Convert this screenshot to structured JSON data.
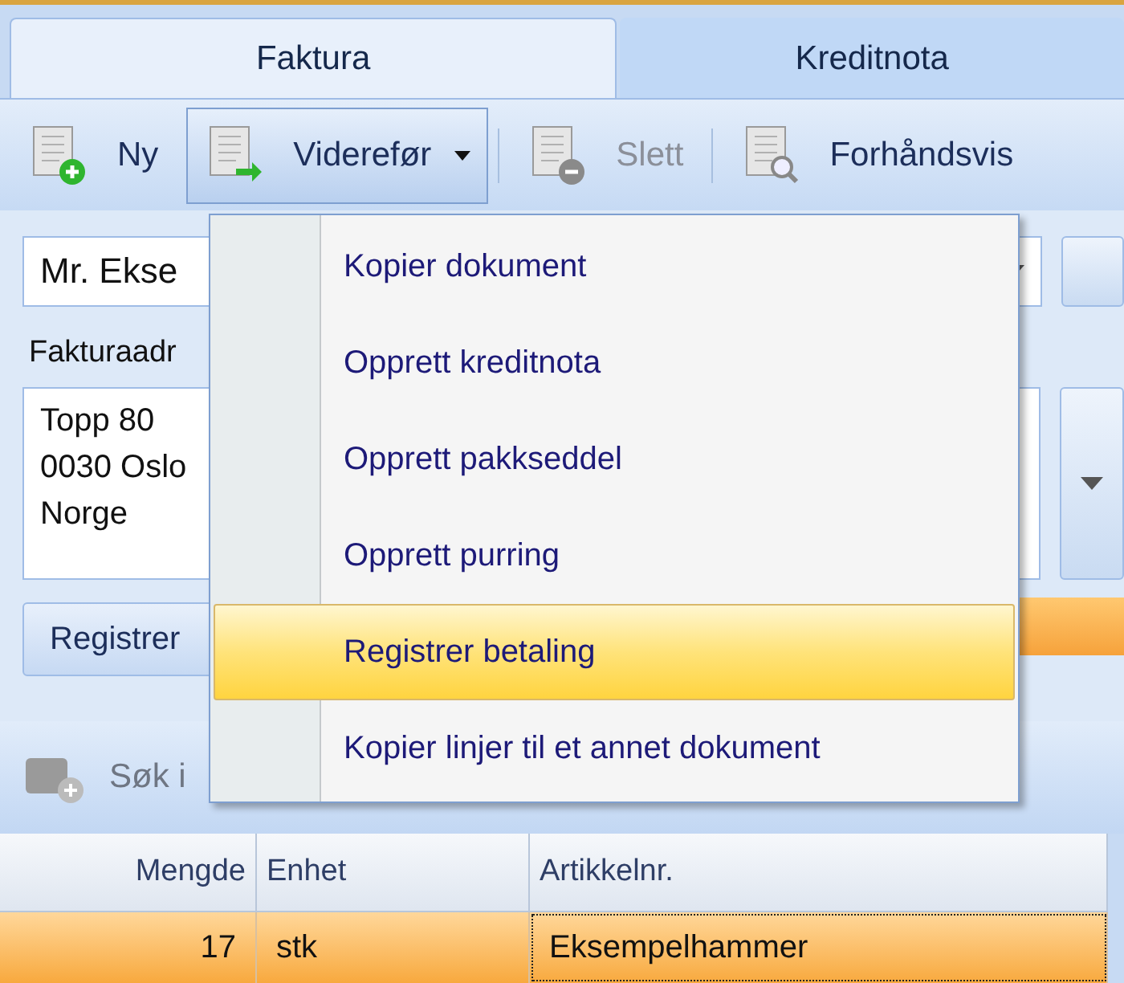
{
  "tabs": [
    {
      "label": "Faktura",
      "selected": true
    },
    {
      "label": "Kreditnota",
      "selected": false
    }
  ],
  "toolbar": [
    {
      "kind": "new",
      "label": "Ny",
      "disabled": false,
      "open": false
    },
    {
      "kind": "forward",
      "label": "Viderefør",
      "disabled": false,
      "open": true
    },
    {
      "kind": "delete",
      "label": "Slett",
      "disabled": true,
      "open": false
    },
    {
      "kind": "preview",
      "label": "Forhåndsvis",
      "disabled": false,
      "open": false
    }
  ],
  "customer": {
    "value": "Mr. Ekse"
  },
  "address_label": "Fakturaadr",
  "address": [
    "Topp 80",
    "0030 Oslo",
    "Norge"
  ],
  "register_button": "Registrer",
  "search_button": "Søk i",
  "columns": [
    {
      "label": "Mengde"
    },
    {
      "label": "Enhet"
    },
    {
      "label": "Artikkelnr."
    }
  ],
  "rows": [
    {
      "selected": true,
      "cells": [
        "17",
        "stk",
        "Eksempelhammer"
      ]
    }
  ],
  "menu": [
    {
      "label": "Kopier dokument",
      "selected": false
    },
    {
      "label": "Opprett kreditnota",
      "selected": false
    },
    {
      "label": "Opprett pakkseddel",
      "selected": false
    },
    {
      "label": "Opprett purring",
      "selected": false
    },
    {
      "label": "Registrer betaling",
      "selected": true
    },
    {
      "label": "Kopier linjer til et annet dokument",
      "selected": false
    }
  ]
}
